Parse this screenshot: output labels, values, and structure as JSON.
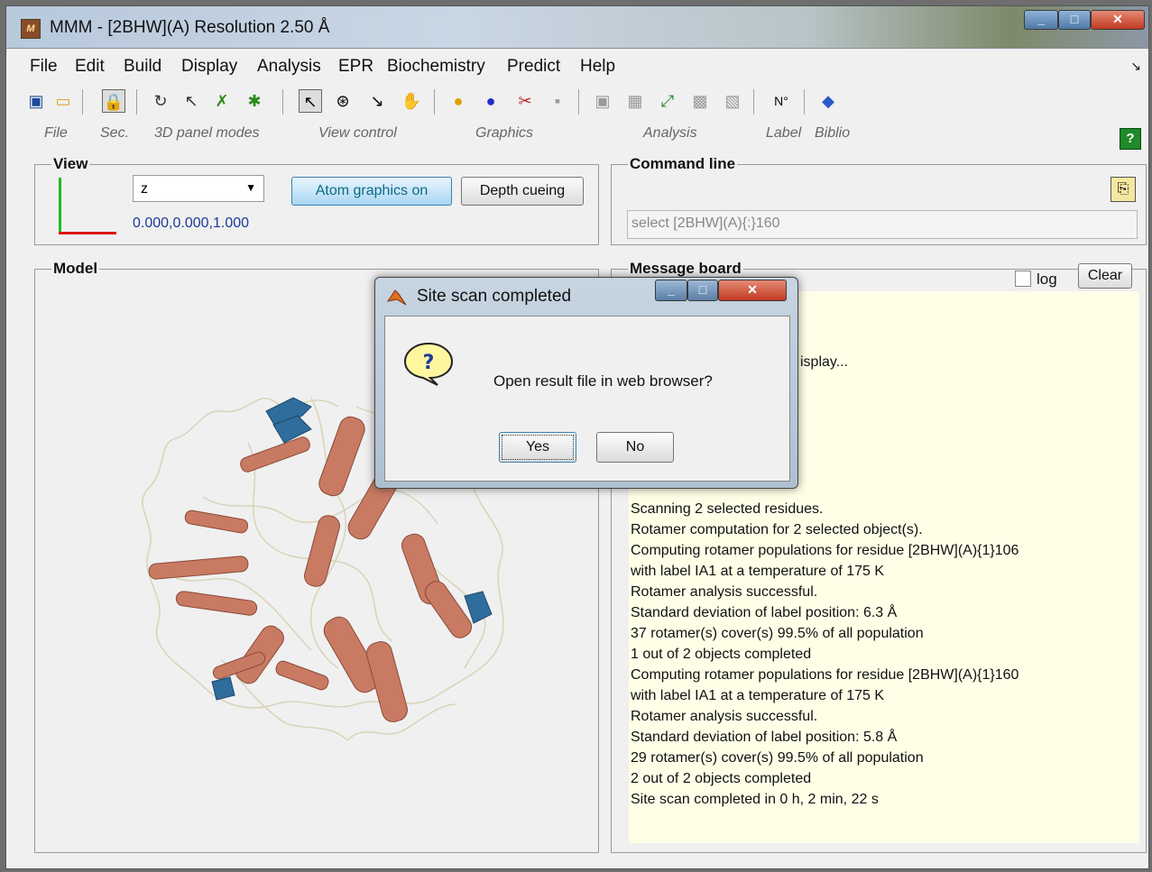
{
  "window": {
    "title": "MMM - [2BHW](A) Resolution 2.50 Å",
    "app_icon_text": "M"
  },
  "menu": [
    "File",
    "Edit",
    "Build",
    "Display",
    "Analysis",
    "EPR",
    "Biochemistry",
    "Predict",
    "Help"
  ],
  "toolbar_groups": [
    "File",
    "Sec.",
    "3D panel modes",
    "View control",
    "Graphics",
    "Analysis",
    "Label",
    "Biblio"
  ],
  "view": {
    "legend": "View",
    "axis_select_value": "z",
    "coords": "0.000,0.000,1.000",
    "atom_graphics_button": "Atom graphics on",
    "depth_cueing_button": "Depth cueing"
  },
  "command_line": {
    "legend": "Command line",
    "value": "select [2BHW](A){:}160"
  },
  "model": {
    "legend": "Model"
  },
  "message_board": {
    "legend": "Message board",
    "log_label": "log",
    "clear_button": "Clear",
    "partial_line": "isplay...",
    "lines": [
      "Scanning 2 selected residues.",
      "Rotamer computation for 2 selected object(s).",
      "Computing rotamer populations for residue [2BHW](A){1}106",
      "with label IA1 at a temperature of 175 K",
      "Rotamer analysis successful.",
      "Standard deviation of label position: 6.3 Å",
      "37 rotamer(s) cover(s) 99.5% of all population",
      "1 out of 2 objects completed",
      "Computing rotamer populations for residue [2BHW](A){1}160",
      "with label IA1 at a temperature of 175 K",
      "Rotamer analysis successful.",
      "Standard deviation of label position: 5.8 Å",
      "29 rotamer(s) cover(s) 99.5% of all population",
      "2 out of 2 objects completed",
      "Site scan completed in 0 h, 2 min, 22 s"
    ]
  },
  "dialog": {
    "title": "Site scan completed",
    "question_mark": "?",
    "message": "Open result file in web browser?",
    "yes": "Yes",
    "no": "No"
  },
  "colors": {
    "helix": "#c87a62",
    "sheet": "#2f6d9c",
    "coil": "#d8d4b8",
    "message_bg": "#ffffe8",
    "atom_graphics_button": "#a9d6f2"
  }
}
